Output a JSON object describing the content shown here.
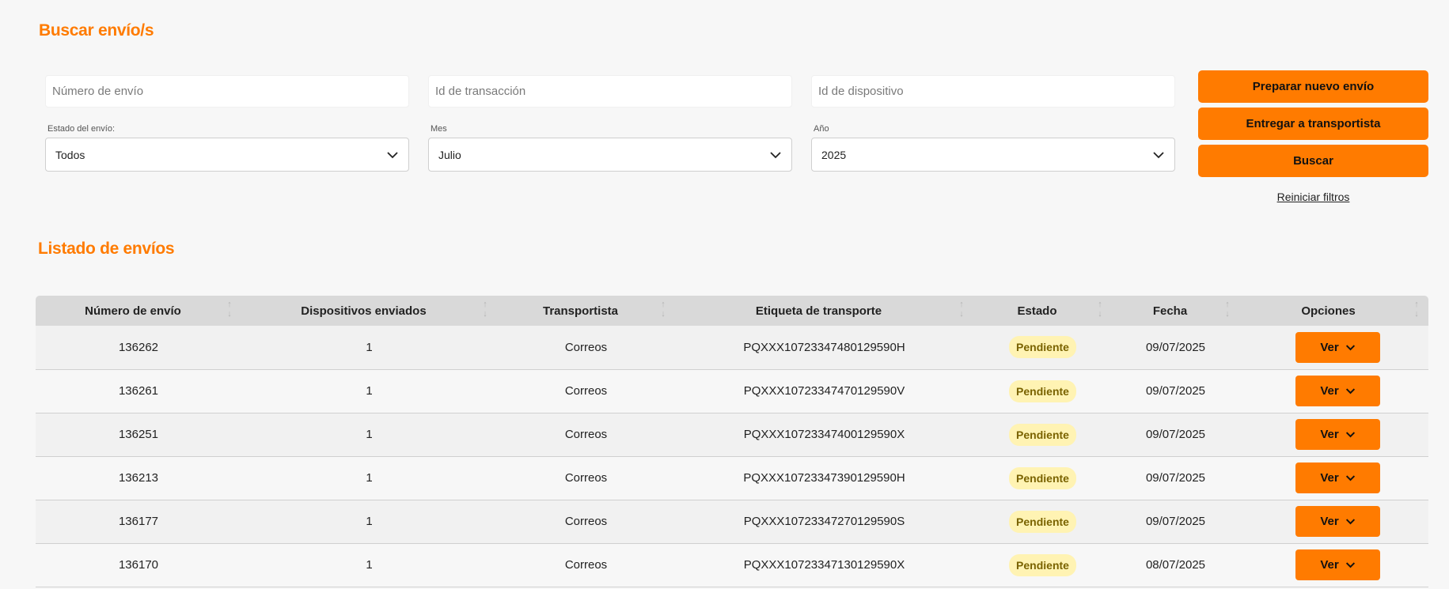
{
  "search": {
    "title": "Buscar envío/s",
    "shipment_number_placeholder": "Número de envío",
    "transaction_id_placeholder": "Id de transacción",
    "device_id_placeholder": "Id de dispositivo",
    "status_label": "Estado del envío:",
    "status_value": "Todos",
    "month_label": "Mes",
    "month_value": "Julio",
    "year_label": "Año",
    "year_value": "2025",
    "prepare_button": "Preparar nuevo envío",
    "deliver_button": "Entregar a transportista",
    "search_button": "Buscar",
    "reset_link": "Reiniciar filtros"
  },
  "list": {
    "title": "Listado de envíos",
    "columns": [
      "Número de envío",
      "Dispositivos enviados",
      "Transportista",
      "Etiqueta de transporte",
      "Estado",
      "Fecha",
      "Opciones"
    ],
    "rows": [
      {
        "number": "136262",
        "devices": "1",
        "carrier": "Correos",
        "label": "PQXXX10723347480129590H",
        "status": "Pendiente",
        "date": "09/07/2025",
        "action": "Ver"
      },
      {
        "number": "136261",
        "devices": "1",
        "carrier": "Correos",
        "label": "PQXXX10723347470129590V",
        "status": "Pendiente",
        "date": "09/07/2025",
        "action": "Ver"
      },
      {
        "number": "136251",
        "devices": "1",
        "carrier": "Correos",
        "label": "PQXXX10723347400129590X",
        "status": "Pendiente",
        "date": "09/07/2025",
        "action": "Ver"
      },
      {
        "number": "136213",
        "devices": "1",
        "carrier": "Correos",
        "label": "PQXXX10723347390129590H",
        "status": "Pendiente",
        "date": "09/07/2025",
        "action": "Ver"
      },
      {
        "number": "136177",
        "devices": "1",
        "carrier": "Correos",
        "label": "PQXXX10723347270129590S",
        "status": "Pendiente",
        "date": "09/07/2025",
        "action": "Ver"
      },
      {
        "number": "136170",
        "devices": "1",
        "carrier": "Correos",
        "label": "PQXXX10723347130129590X",
        "status": "Pendiente",
        "date": "08/07/2025",
        "action": "Ver"
      }
    ]
  },
  "colors": {
    "accent": "#ff7b00",
    "badge_bg": "#fff3b3",
    "badge_text": "#7a6300",
    "header_bg": "#d9d9d9"
  },
  "icons": {
    "select": "chevron-down-icon",
    "sort": "sort-arrows-icon",
    "ver": "chevron-down-icon"
  }
}
